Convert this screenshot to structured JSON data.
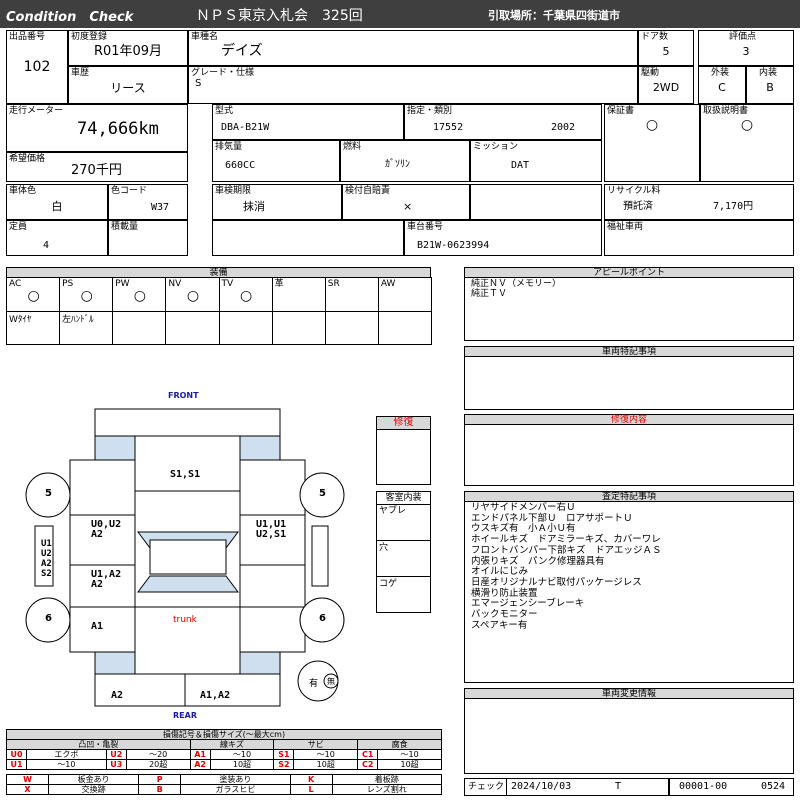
{
  "header": {
    "title_left": "Condition　Check",
    "auction": "ＮＰＳ東京入札会　325回",
    "pickup": "引取場所：千葉県四街道市"
  },
  "row1": {
    "lot_label": "出品番号",
    "lot": "102",
    "reg_label": "初度登録",
    "reg": "R01年09月",
    "name_label": "車種名",
    "name": "デイズ",
    "doors_label": "ドア数",
    "doors": "5",
    "score_label": "評価点",
    "score": "3",
    "history_label": "車歴",
    "history": "リース",
    "grade_label": "グレード・仕様",
    "grade": "S",
    "drive_label": "駆動",
    "drive": "2WD",
    "ext_label": "外装",
    "ext": "C",
    "int_label": "内装",
    "int": "B"
  },
  "row2": {
    "odo_label": "走行メーター",
    "odo": "74,666km",
    "price_label": "希望価格",
    "price": "270千円",
    "model_label": "型式",
    "model": "DBA-B21W",
    "cat_label": "指定・類別",
    "cat1": "17552",
    "cat2": "2002",
    "warranty_label": "保証書",
    "warranty": "○",
    "manual_label": "取扱説明書",
    "manual": "○",
    "disp_label": "排気量",
    "disp": "660CC",
    "fuel_label": "燃料",
    "fuel": "ｶﾞｿﾘﾝ",
    "mission_label": "ミッション",
    "mission": "DAT"
  },
  "row3": {
    "color_label": "車体色",
    "color": "白",
    "code_label": "色コード",
    "code": "W37",
    "inspect_label": "車検期限",
    "inspect": "抹消",
    "insure_label": "検付自賠責",
    "insure": "×",
    "recycle_label": "リサイクル料",
    "recycle_status": "預託済",
    "recycle_amount": "7,170円",
    "cap_label": "定員",
    "cap": "4",
    "load_label": "積載量",
    "chassis_label": "車台番号",
    "chassis": "B21W-0623994",
    "welfare_label": "福祉車両"
  },
  "equipment": {
    "title": "装備",
    "top": [
      {
        "label": "AC",
        "mark": "○"
      },
      {
        "label": "PS",
        "mark": "○"
      },
      {
        "label": "PW",
        "mark": "○"
      },
      {
        "label": "NV",
        "mark": "○"
      },
      {
        "label": "TV",
        "mark": "○"
      },
      {
        "label": "革",
        "mark": ""
      },
      {
        "label": "SR",
        "mark": ""
      },
      {
        "label": "AW",
        "mark": ""
      }
    ],
    "bottom": [
      "Wﾀｲﾔ",
      "左ﾊﾝﾄﾞﾙ",
      "",
      "",
      "",
      "",
      "",
      ""
    ]
  },
  "appeal": {
    "title": "アピールポイント",
    "lines": [
      "純正ＮＶ（メモリー）",
      "純正ＴＶ"
    ]
  },
  "special": {
    "title": "車両特記事項"
  },
  "repair_content": {
    "title": "修復内容"
  },
  "inspection": {
    "title": "査定特記事項",
    "lines": [
      "リヤサイドメンバー右Ｕ",
      "エンドパネル下部Ｕ　ロアサポートＵ",
      "ウスキズ有　小Ａ小Ｕ有",
      "ホイールキズ　ドアミラーキズ、カバーワレ",
      "フロントバンパー下部キズ　ドアエッジＡＳ",
      "内張りキズ　パンク修理器具有",
      "オイルにじみ",
      "日産オリジナルナビ取付パッケージレス",
      "横滑り防止装置",
      "エマージェンシーブレーキ",
      "バックモニター",
      "スペアキー有"
    ]
  },
  "changes": {
    "title": "車両変更情報"
  },
  "diagram": {
    "front": "FRONT",
    "rear": "REAR",
    "trunk": "trunk",
    "hood": "S1,S1",
    "left_front_door": [
      "U0,U2",
      "A2"
    ],
    "left_rear_door": [
      "U1,A2",
      "A2"
    ],
    "right_front_door": [
      "U1,U1",
      "U2,S1"
    ],
    "left_rear_panel": "A1",
    "rear_left": "A2",
    "rear_right": "A1,A2",
    "side_mirror_marks": [
      "U1",
      "U2",
      "A2",
      "S2"
    ],
    "wheels": [
      "5",
      "5",
      "6",
      "6"
    ],
    "spare_label": "有",
    "spare_icon": "無"
  },
  "repair": {
    "title": "修復"
  },
  "interior": {
    "title": "客室内装",
    "rows": [
      "ヤブレ",
      "穴",
      "コゲ"
    ]
  },
  "legend": {
    "title": "損傷記号＆損傷サイズ(～最大cm)",
    "groups": [
      "凸凹・亀裂",
      "線キズ",
      "サビ",
      "腐食"
    ],
    "rows": [
      [
        [
          "U0",
          "エクボ"
        ],
        [
          "U2",
          "～20"
        ],
        [
          "A1",
          "～10"
        ],
        [
          "S1",
          "～10"
        ],
        [
          "C1",
          "～10"
        ]
      ],
      [
        [
          "U1",
          "～10"
        ],
        [
          "U3",
          "20超"
        ],
        [
          "A2",
          "10超"
        ],
        [
          "S2",
          "10超"
        ],
        [
          "C2",
          "10超"
        ]
      ]
    ],
    "codes": [
      [
        [
          "W",
          "板金あり"
        ],
        [
          "P",
          "塗装あり"
        ],
        [
          "K",
          "着板跡"
        ]
      ],
      [
        [
          "X",
          "交換跡"
        ],
        [
          "B",
          "ガラスヒビ"
        ],
        [
          "L",
          "レンズ割れ"
        ]
      ]
    ]
  },
  "footer": {
    "check_label": "チェック",
    "date": "2024/10/03",
    "code": "T",
    "num": "00001-00",
    "num2": "0524"
  },
  "colors": {
    "bar": "#3f3f3f",
    "repair_red": "#e00000",
    "accent_blue": "#1a1aa8",
    "panel_blue": "#cfdff0"
  }
}
